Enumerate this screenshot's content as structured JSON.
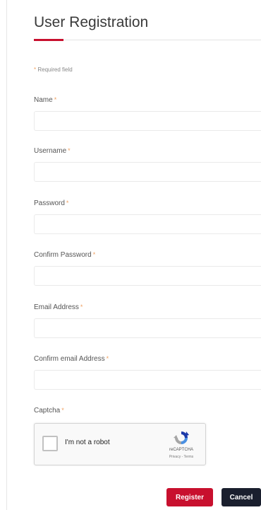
{
  "header": {
    "title": "User Registration"
  },
  "form": {
    "required_note": "Required field",
    "required_marker": "*",
    "fields": [
      {
        "label": "Name",
        "value": ""
      },
      {
        "label": "Username",
        "value": ""
      },
      {
        "label": "Password",
        "value": ""
      },
      {
        "label": "Confirm Password",
        "value": ""
      },
      {
        "label": "Email Address",
        "value": ""
      },
      {
        "label": "Confirm email Address",
        "value": ""
      }
    ],
    "captcha_label": "Captcha"
  },
  "captcha": {
    "checkbox_text": "I'm not a robot",
    "brand": "reCAPTCHA",
    "links": "Privacy - Terms"
  },
  "actions": {
    "register_label": "Register",
    "cancel_label": "Cancel"
  },
  "colors": {
    "accent": "#c8102e",
    "dark_button": "#1a1f2e",
    "required_star": "#f0a060"
  }
}
